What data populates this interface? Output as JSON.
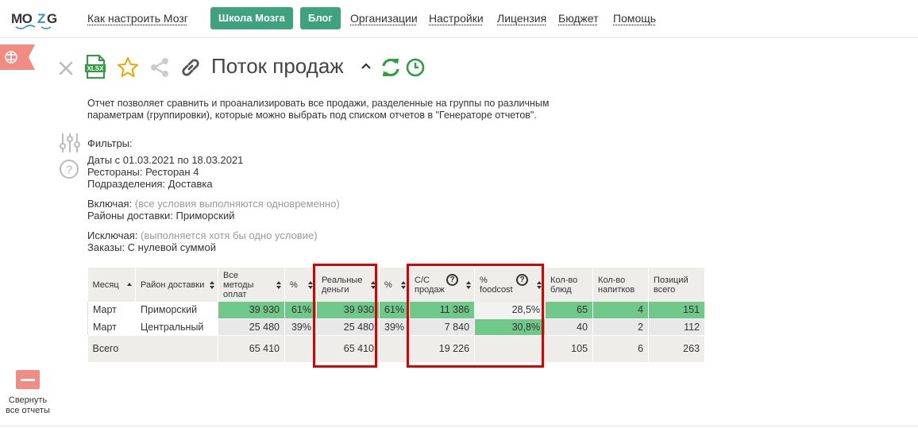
{
  "nav": {
    "logo": "MOZG",
    "links": [
      "Как настроить Мозг",
      "Организации",
      "Настройки",
      "Лицензия",
      "Бюджет",
      "Помощь"
    ],
    "school_btn": "Школа Мозга",
    "blog_btn": "Блог"
  },
  "report": {
    "title": "Поток продаж",
    "description": "Отчет позволяет сравнить и проанализировать все продажи, разделенные на группы по различным параметрам (группировки), которые можно выбрать под списком отчетов в \"Генераторе отчетов\"."
  },
  "filters": {
    "heading": "Фильтры:",
    "dates_label": "Даты",
    "dates_value": " с 01.03.2021 по 18.03.2021",
    "restaurants_label": "Рестораны:",
    "restaurants_value": " Ресторан 4",
    "divisions_label": "Подразделения:",
    "divisions_value": " Доставка",
    "include_label": "Включая:",
    "include_note": " (все условия выполняются одновременно)",
    "districts_label": "Районы доставки:",
    "districts_value": " Приморский",
    "exclude_label": "Исключая:",
    "exclude_note": " (выполняется хотя бы одно условие)",
    "orders_label": "Заказы:",
    "orders_value": " С нулевой суммой"
  },
  "table": {
    "headers": [
      "Месяц",
      "Район доставки",
      "Все методы оплат",
      "%",
      "Реальные деньги",
      "%",
      "С/С продаж",
      "% foodcost",
      "Кол-во блюд",
      "Кол-во напитков",
      "Позиций всего"
    ],
    "rows": [
      [
        "Март",
        "Приморский",
        "39 930",
        "61%",
        "39 930",
        "61%",
        "11 386",
        "28,5%",
        "65",
        "4",
        "151"
      ],
      [
        "Март",
        "Центральный",
        "25 480",
        "39%",
        "25 480",
        "39%",
        "7 840",
        "30,8%",
        "40",
        "2",
        "112"
      ]
    ],
    "total": [
      "Всего",
      "65 410",
      "65 410",
      "19 226",
      "105",
      "6",
      "263"
    ]
  },
  "sidebar": {
    "collapse_label_1": "Свернуть",
    "collapse_label_2": "все отчеты"
  },
  "colors": {
    "accent": "#3fa27f",
    "highlight": "#70c889",
    "annotation": "#d90000"
  }
}
